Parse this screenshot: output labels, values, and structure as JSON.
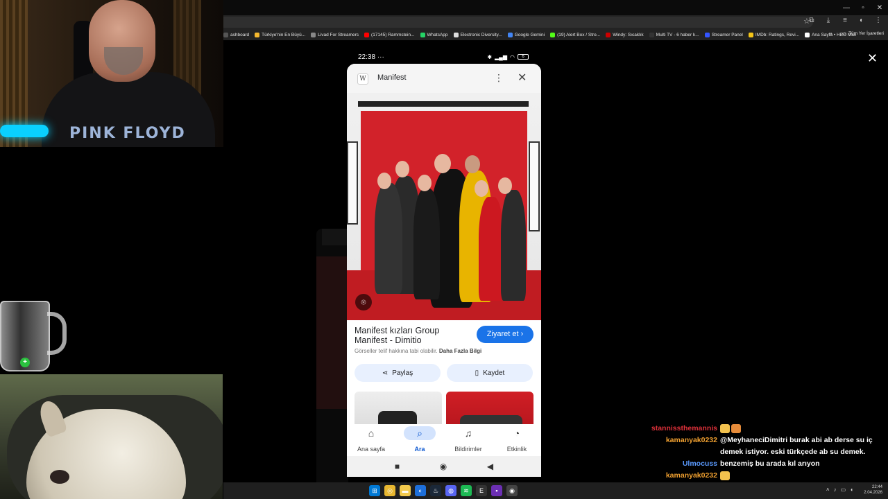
{
  "browser": {
    "bookmarks": [
      {
        "label": "ashboard",
        "color": "#555555"
      },
      {
        "label": "Türkiye'nin En Büyü...",
        "color": "#f5b82e"
      },
      {
        "label": "Livad For Streamers",
        "color": "#888888"
      },
      {
        "label": "(17145) Rammstein...",
        "color": "#ff0000"
      },
      {
        "label": "WhatsApp",
        "color": "#25d366"
      },
      {
        "label": "Electronic Diversity...",
        "color": "#dddddd"
      },
      {
        "label": "Google Gemini",
        "color": "#4285f4"
      },
      {
        "label": "(19) Alert Box / Stre...",
        "color": "#53fc18"
      },
      {
        "label": "Windy: Sıcaklık",
        "color": "#cc0000"
      },
      {
        "label": "Multi TV - 6 haber k...",
        "color": "#333333"
      },
      {
        "label": "Streamer Panel",
        "color": "#3355ff"
      },
      {
        "label": "IMDb: Ratings, Revi...",
        "color": "#f5c518"
      },
      {
        "label": "Ana Sayfa • HBO Max",
        "color": "#ffffff"
      }
    ],
    "more_bookmarks": "»",
    "all_bookmarks": "Tüm Yer İşaretleri"
  },
  "phone": {
    "time": "22:38",
    "dots": "···",
    "battery": "6",
    "sheet": {
      "site_icon": "W",
      "title": "Manifest",
      "result_title_line1": "Manifest kızları Group",
      "result_title_line2": "Manifest - Dimitio",
      "visit_label": "Ziyaret et",
      "copyright_text": "Görseller telif hakkına tabi olabilir.",
      "more_info": "Daha Fazla Bilgi",
      "share_label": "Paylaş",
      "save_label": "Kaydet"
    },
    "nav": [
      {
        "label": "Ana sayfa",
        "icon": "home-icon",
        "active": false
      },
      {
        "label": "Ara",
        "icon": "search-icon",
        "active": true
      },
      {
        "label": "Bildirimler",
        "icon": "bell-icon",
        "active": false
      },
      {
        "label": "Etkinlik",
        "icon": "activity-icon",
        "active": false
      }
    ]
  },
  "chat": [
    {
      "user": "stannissthemannis",
      "color": "#e0313a",
      "text": "",
      "emotes": 2
    },
    {
      "user": "kamanyak0232",
      "color": "#f0a030",
      "text": "@MeyhaneciDimitri burak abi ab derse su iç demek istiyor. eski türkçede ab su demek.",
      "emotes": 0
    },
    {
      "user": "Ulmocuss",
      "color": "#5b9bff",
      "text": "benzemiş bu arada kıl arıyon",
      "emotes": 0
    },
    {
      "user": "kamanyak0232",
      "color": "#f0a030",
      "text": "",
      "emotes": 1
    },
    {
      "user": "kamanyak0232",
      "color": "#f0a030",
      "text": "",
      "emotes": 1
    }
  ],
  "taskbar": {
    "time": "22:44",
    "date": "2.04.2026"
  },
  "webcam": {
    "shirt_text": "PINK FLOYD"
  },
  "colors": {
    "visit_button": "#1a73e8",
    "active_nav": "#0b57d0",
    "pill_bg": "#e8f0fe",
    "backdrop_red": "#d2222a"
  }
}
